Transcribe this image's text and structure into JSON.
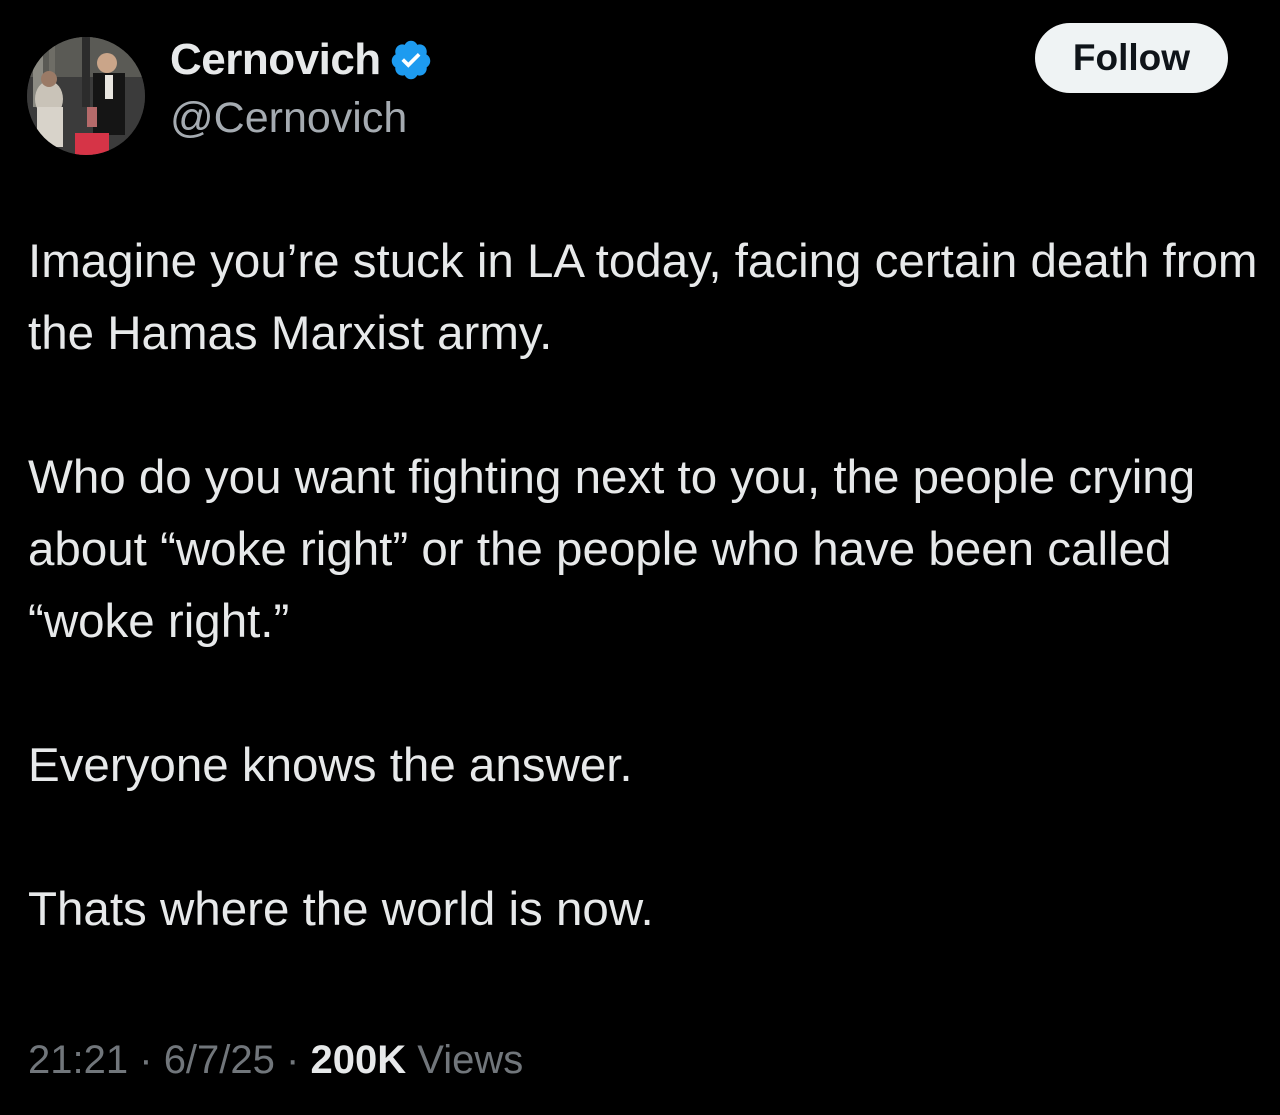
{
  "author": {
    "display_name": "Cernovich",
    "handle": "@Cernovich",
    "verified_color": "#1d9bf0",
    "verified_icon": "verified-badge-icon"
  },
  "follow_button": {
    "label": "Follow"
  },
  "tweet": {
    "paragraphs": [
      "Imagine you’re stuck in LA today, facing certain death from the Hamas Marxist army.",
      "Who do you want fighting next to you, the people crying about “woke right” or the people who have been called “woke right.”",
      "Everyone knows the answer.",
      "Thats where the world is now."
    ]
  },
  "meta": {
    "time": "21:21",
    "separator": "·",
    "date": "6/7/25",
    "views_count": "200K",
    "views_label": "Views"
  },
  "colors": {
    "background": "#000000",
    "text_primary": "#e7e9ea",
    "text_secondary": "#71767b",
    "button_bg": "#eff3f4"
  }
}
